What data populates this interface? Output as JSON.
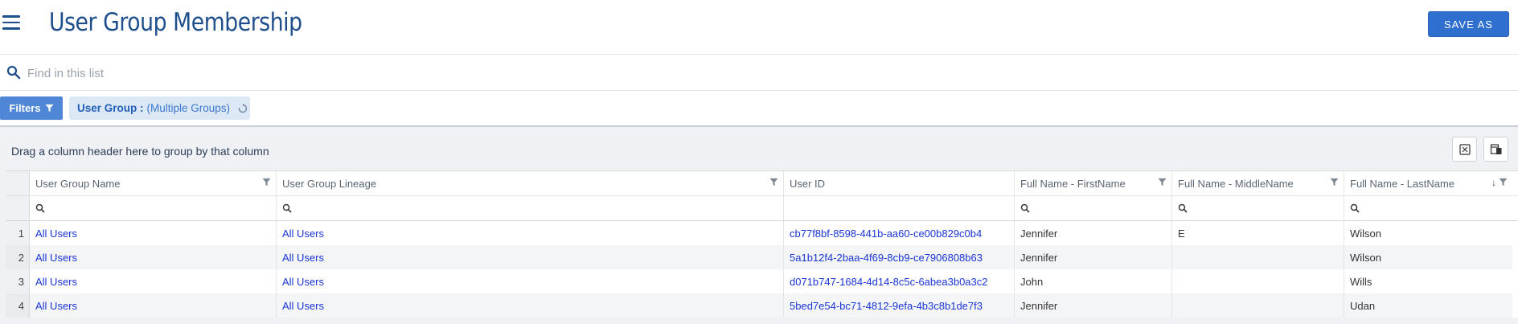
{
  "header": {
    "title": "User Group Membership",
    "save_label": "SAVE AS"
  },
  "search": {
    "placeholder": "Find in this list"
  },
  "filters": {
    "button_label": "Filters",
    "chip_label": "User Group :",
    "chip_value": "(Multiple Groups)"
  },
  "grid": {
    "group_hint": "Drag a column header here to group by that column",
    "columns": [
      "User Group Name",
      "User Group Lineage",
      "User ID",
      "Full Name - FirstName",
      "Full Name - MiddleName",
      "Full Name - LastName"
    ],
    "rows": [
      {
        "n": "1",
        "group": "All Users",
        "lineage": "All Users",
        "user_id": "cb77f8bf-8598-441b-aa60-ce00b829c0b4",
        "first": "Jennifer",
        "middle": "E",
        "last": "Wilson"
      },
      {
        "n": "2",
        "group": "All Users",
        "lineage": "All Users",
        "user_id": "5a1b12f4-2baa-4f69-8cb9-ce7906808b63",
        "first": "Jennifer",
        "middle": "",
        "last": "Wilson"
      },
      {
        "n": "3",
        "group": "All Users",
        "lineage": "All Users",
        "user_id": "d071b747-1684-4d14-8c5c-6abea3b0a3c2",
        "first": "John",
        "middle": "",
        "last": "Wills"
      },
      {
        "n": "4",
        "group": "All Users",
        "lineage": "All Users",
        "user_id": "5bed7e54-bc71-4812-9efa-4b3c8b1de7f3",
        "first": "Jennifer",
        "middle": "",
        "last": "Udan"
      }
    ]
  },
  "icons": {
    "menu": "hamburger-menu-icon",
    "search": "search-icon",
    "filter": "filter-funnel-icon",
    "reset": "reset-icon",
    "export": "export-excel-icon",
    "columns": "column-chooser-icon",
    "sort": "sort-descending-icon"
  },
  "colors": {
    "brand": "#1f4e8c",
    "primary_button": "#2f6fce",
    "link": "#1a35d6",
    "chip_bg": "#dde8f6"
  }
}
